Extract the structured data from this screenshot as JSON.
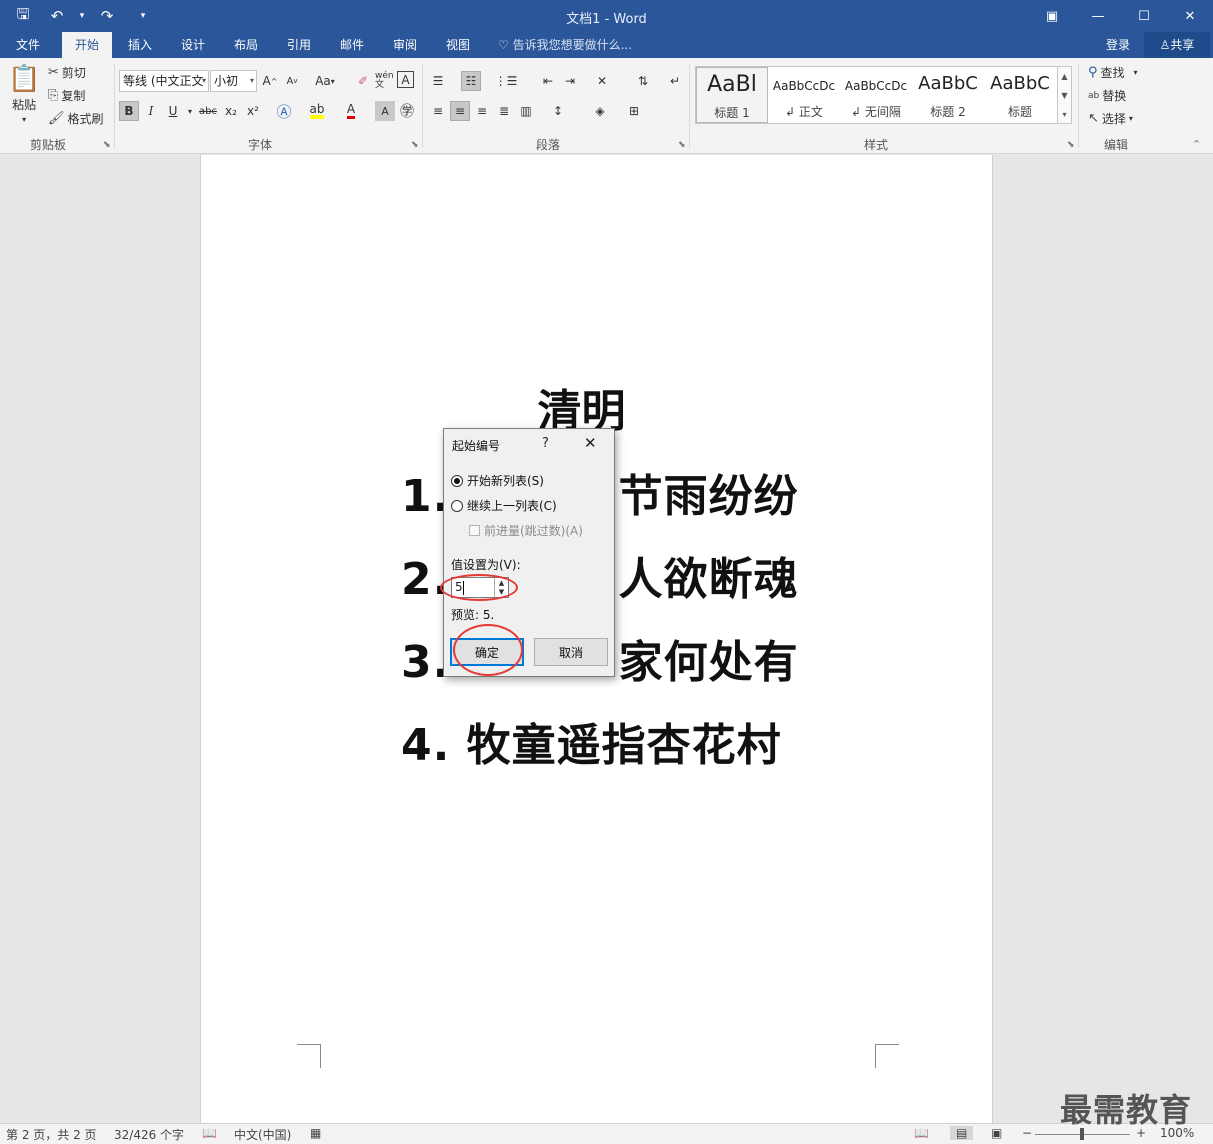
{
  "window": {
    "title": "文档1 - Word",
    "qat": {
      "save": "🖫",
      "undo": "↶",
      "undo_dd": "▾",
      "redo": "↷",
      "customize": "▾"
    },
    "controls": {
      "restore_ribbon": "▣",
      "minimize": "—",
      "maximize": "☐",
      "close": "✕"
    }
  },
  "tabs": [
    {
      "label": "文件",
      "active": false
    },
    {
      "label": "开始",
      "active": true
    },
    {
      "label": "插入",
      "active": false
    },
    {
      "label": "设计",
      "active": false
    },
    {
      "label": "布局",
      "active": false
    },
    {
      "label": "引用",
      "active": false
    },
    {
      "label": "邮件",
      "active": false
    },
    {
      "label": "审阅",
      "active": false
    },
    {
      "label": "视图",
      "active": false
    }
  ],
  "tell_me": "告诉我您想要做什么...",
  "signin": "登录",
  "share": "共享",
  "ribbon": {
    "clipboard": {
      "paste": "粘贴",
      "cut": "剪切",
      "copy": "复制",
      "format_painter": "格式刷",
      "label": "剪贴板"
    },
    "font": {
      "font_name": "等线 (中文正文",
      "font_size": "小初",
      "bold": "B",
      "italic": "I",
      "underline": "U",
      "strikethrough": "abc",
      "subscript": "x₂",
      "superscript": "x²",
      "change_case": "Aa",
      "grow": "A",
      "shrink": "A",
      "phonetic": "wén 文",
      "label": "字体"
    },
    "paragraph": {
      "label": "段落"
    },
    "styles": {
      "label": "样式",
      "items": [
        {
          "sample": "AaBl",
          "name": "标题 1"
        },
        {
          "sample": "AaBbCcDc",
          "name": "正文"
        },
        {
          "sample": "AaBbCcDc",
          "name": "无间隔"
        },
        {
          "sample": "AaBbC",
          "name": "标题 2"
        },
        {
          "sample": "AaBbC",
          "name": "标题"
        }
      ]
    },
    "editing": {
      "find": "查找",
      "replace": "替换",
      "select": "选择",
      "label": "编辑"
    }
  },
  "document": {
    "title": "清明",
    "lines": [
      {
        "num": "1.",
        "text": "节雨纷纷"
      },
      {
        "num": "2.",
        "text": "人欲断魂"
      },
      {
        "num": "3.",
        "text": "家何处有"
      },
      {
        "num": "4.",
        "text": "牧童遥指杏花村"
      }
    ]
  },
  "dialog": {
    "title": "起始编号",
    "help": "?",
    "close": "✕",
    "option_new": "开始新列表(S)",
    "option_continue": "继续上一列表(C)",
    "advance": "前进量(跳过数)(A)",
    "value_label": "值设置为(V):",
    "value": "5",
    "preview": "预览: 5.",
    "ok": "确定",
    "cancel": "取消"
  },
  "status": {
    "page": "第 2 页，共 2 页",
    "words": "32/426 个字",
    "language": "中文(中国)",
    "zoom": "100%",
    "zoom_minus": "−",
    "zoom_plus": "+"
  },
  "watermark": "最需教育"
}
